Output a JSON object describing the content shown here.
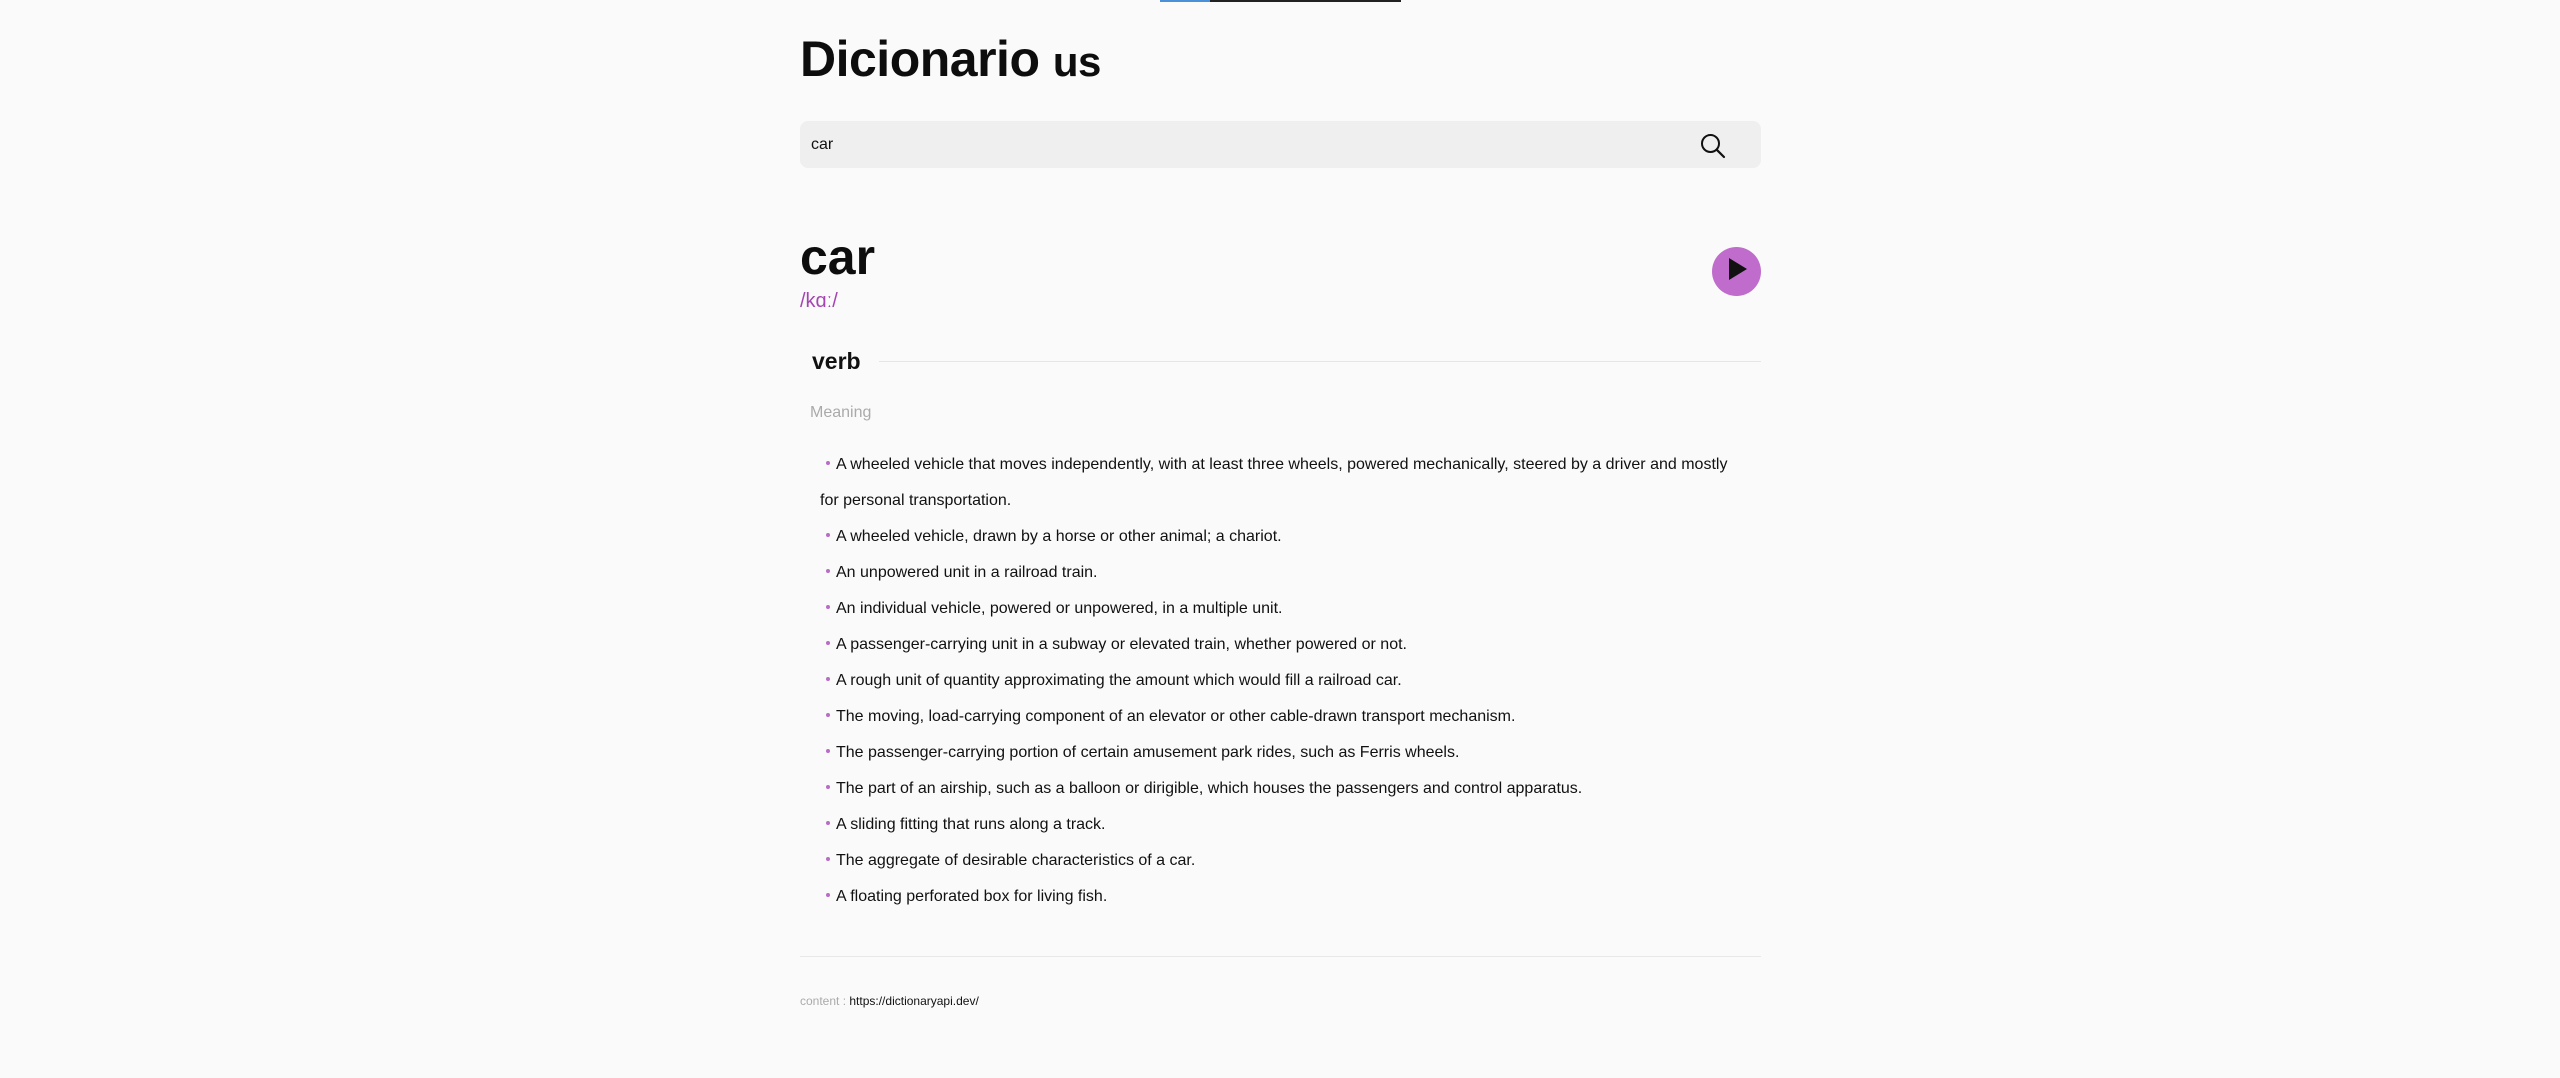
{
  "brand": {
    "title": "Dicionario",
    "suffix": "us"
  },
  "search": {
    "value": "car",
    "icon": "search-icon"
  },
  "entry": {
    "word": "car",
    "phonetic": "/kɑː/",
    "play_icon": "play-icon",
    "accent_color": "#c06ccc",
    "meanings": [
      {
        "part_of_speech": "verb",
        "label": "Meaning",
        "definitions": [
          "A wheeled vehicle that moves independently, with at least three wheels, powered mechanically, steered by a driver and mostly for personal transportation.",
          "A wheeled vehicle, drawn by a horse or other animal; a chariot.",
          "An unpowered unit in a railroad train.",
          "An individual vehicle, powered or unpowered, in a multiple unit.",
          "A passenger-carrying unit in a subway or elevated train, whether powered or not.",
          "A rough unit of quantity approximating the amount which would fill a railroad car.",
          "The moving, load-carrying component of an elevator or other cable-drawn transport mechanism.",
          "The passenger-carrying portion of certain amusement park rides, such as Ferris wheels.",
          "The part of an airship, such as a balloon or dirigible, which houses the passengers and control apparatus.",
          "A sliding fitting that runs along a track.",
          "The aggregate of desirable characteristics of a car.",
          "A floating perforated box for living fish."
        ]
      }
    ]
  },
  "footer": {
    "label": "content :",
    "link": "https://dictionaryapi.dev/"
  }
}
